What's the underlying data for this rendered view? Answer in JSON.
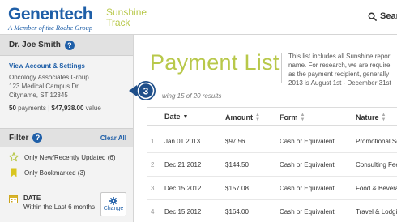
{
  "header": {
    "logo_main": "Genentech",
    "logo_sub": "A Member of the Roche Group",
    "app_name_line1": "Sunshine",
    "app_name_line2": "Track",
    "search_label": "Search"
  },
  "sidebar": {
    "user_name": "Dr. Joe Smith",
    "help_label": "?",
    "account_link": "View Account & Settings",
    "address": [
      "Oncology Associates Group",
      "123 Medical Campus Dr.",
      "Cityname, ST 12345"
    ],
    "payments_count": "50",
    "payments_label": "payments",
    "total_value": "$47,938.00",
    "value_label": "value",
    "filter_title": "Filter",
    "clear_all": "Clear All",
    "filters": [
      {
        "label": "Only New/Recently Updated (6)",
        "icon": "star-outline-icon"
      },
      {
        "label": "Only Bookmarked (3)",
        "icon": "bookmark-icon"
      }
    ],
    "date_label": "DATE",
    "date_value": "Within the Last 6 months",
    "change_label": "Change"
  },
  "main": {
    "title": "Payment List",
    "intro_lines": [
      "This list includes all Sunshine repor",
      "name. For research, we are require",
      "as the payment recipient, generally",
      "2013 is August 1st - December 31st"
    ],
    "showing": "wing 15 of 20 results",
    "callout_number": "3",
    "columns": [
      "Date",
      "Amount",
      "Form",
      "Nature"
    ],
    "rows": [
      {
        "num": "1",
        "date": "Jan 01 2013",
        "amount": "$97.56",
        "form": "Cash or Equivalent",
        "nature": "Promotional Se"
      },
      {
        "num": "2",
        "date": "Dec 21 2012",
        "amount": "$144.50",
        "form": "Cash or Equivalent",
        "nature": "Consulting Fee"
      },
      {
        "num": "3",
        "date": "Dec 15 2012",
        "amount": "$157.08",
        "form": "Cash or Equivalent",
        "nature": "Food & Bevera"
      },
      {
        "num": "4",
        "date": "Dec 15 2012",
        "amount": "$164.00",
        "form": "Cash or Equivalent",
        "nature": "Travel & Lodgi"
      }
    ]
  },
  "colors": {
    "brand_blue": "#1f5fa8",
    "accent_green": "#b8c84a",
    "bookmark_yellow": "#d9c51e"
  }
}
